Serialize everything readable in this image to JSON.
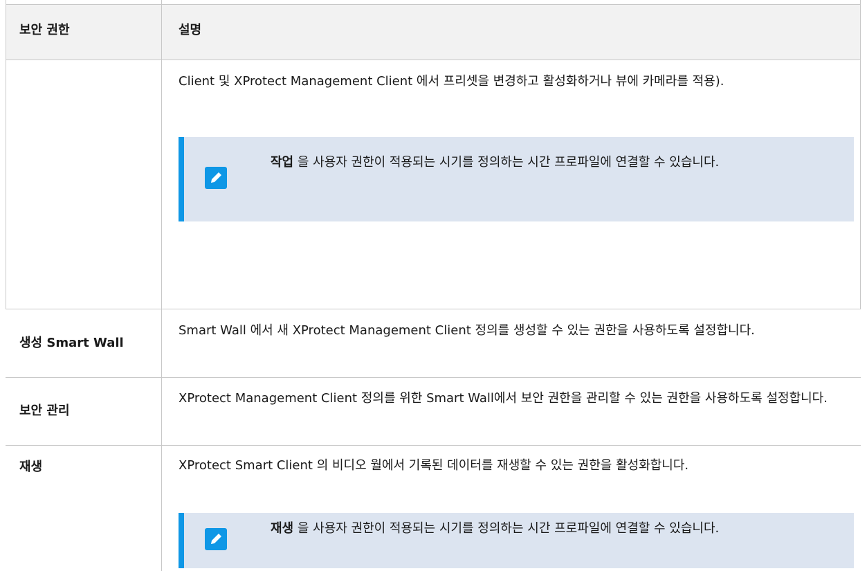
{
  "header": {
    "col1": "보안 권한",
    "col2": "설명"
  },
  "rows": [
    {
      "label": "",
      "desc": "Client 및 XProtect Management Client 에서 프리셋을 변경하고 활성화하거나 뷰에 카메라를 적용).",
      "note": {
        "bold": "작업",
        "text": " 을 사용자 권한이 적용되는 시기를 정의하는 시간 프로파일에 연결할 수 있습니다."
      }
    },
    {
      "label": "생성 Smart Wall",
      "desc": "Smart Wall 에서 새 XProtect Management Client 정의를 생성할 수 있는 권한을 사용하도록 설정합니다."
    },
    {
      "label": "보안 관리",
      "desc": "XProtect Management Client 정의를 위한 Smart Wall에서 보안 권한을 관리할 수 있는 권한을 사용하도록 설정합니다."
    },
    {
      "label": "재생",
      "desc": "XProtect Smart Client 의 비디오 월에서 기록된 데이터를 재생할 수 있는 권한을 활성화합니다.",
      "note": {
        "bold": "재생",
        "text": " 을 사용자 권한이 적용되는 시기를 정의하는 시간 프로파일에 연결할 수 있습니다."
      }
    }
  ],
  "icons": {
    "note": "pencil-note-icon"
  },
  "colors": {
    "note_bg": "#dce4f0",
    "accent": "#0f97e6",
    "header_bg": "#f2f2f2"
  }
}
